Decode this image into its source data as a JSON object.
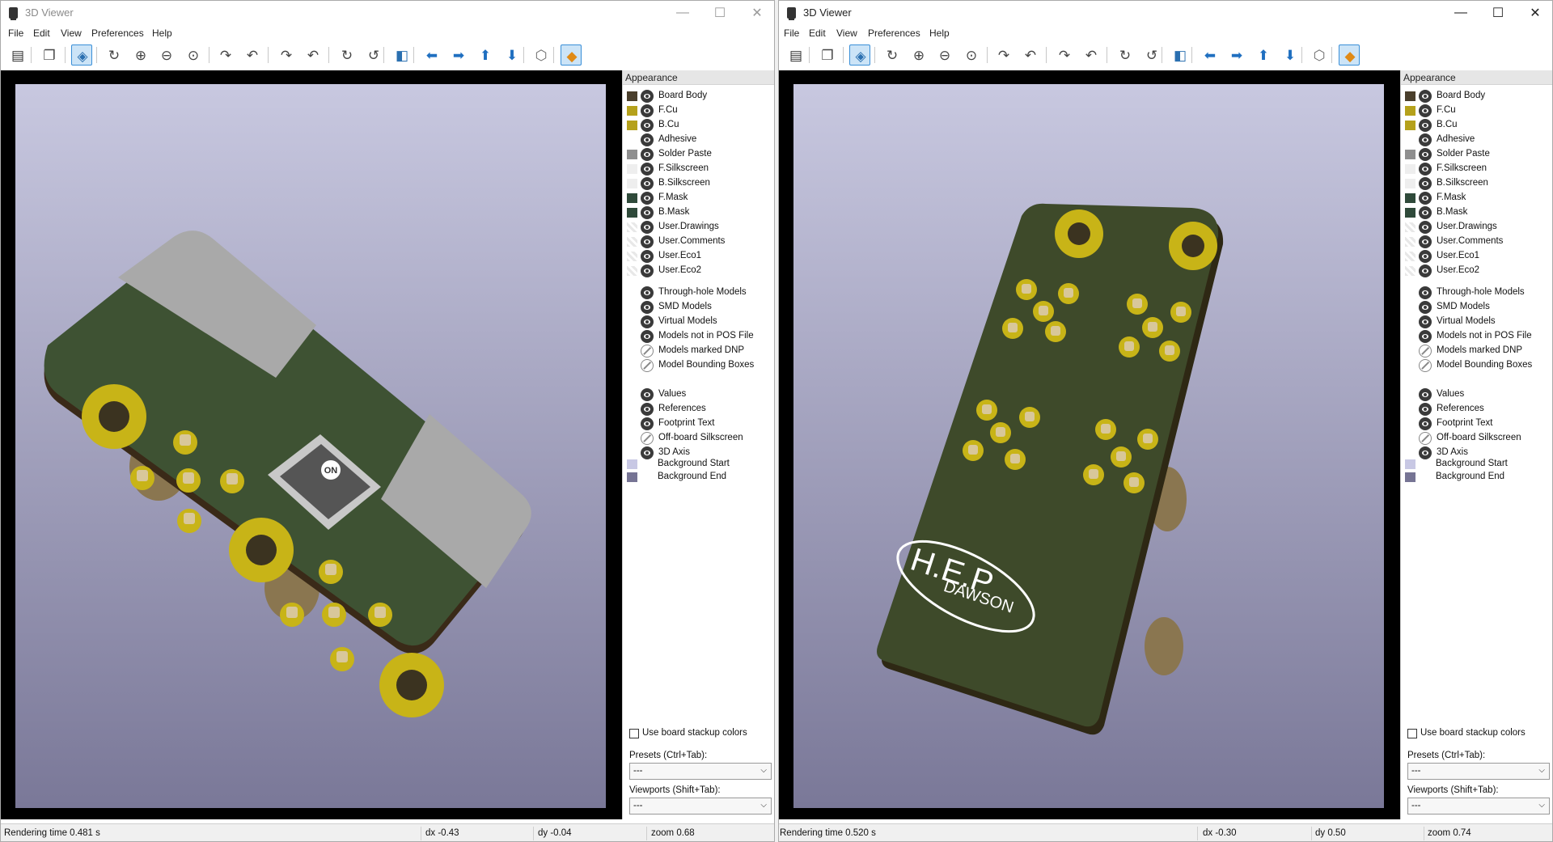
{
  "windows": [
    {
      "title": "3D Viewer",
      "active": false,
      "menu": [
        "File",
        "Edit",
        "View",
        "Preferences",
        "Help"
      ],
      "panel_title": "Appearance",
      "status": {
        "render": "Rendering time 0.481 s",
        "dx": "dx -0.43",
        "dy": "dy -0.04",
        "zoom": "zoom 0.68"
      }
    },
    {
      "title": "3D Viewer",
      "active": true,
      "menu": [
        "File",
        "Edit",
        "View",
        "Preferences",
        "Help"
      ],
      "panel_title": "Appearance",
      "status": {
        "render": "Rendering time 0.520 s",
        "dx": "dx -0.30",
        "dy": "dy 0.50",
        "zoom": "zoom 0.74"
      }
    }
  ],
  "layers": [
    {
      "label": "Board Body",
      "color": "#4a3f2c",
      "swatch": "solid",
      "visible": true
    },
    {
      "label": "F.Cu",
      "color": "#b5a11b",
      "swatch": "solid",
      "visible": true
    },
    {
      "label": "B.Cu",
      "color": "#b5a11b",
      "swatch": "solid",
      "visible": true
    },
    {
      "label": "Adhesive",
      "color": "#ffffff",
      "swatch": "none",
      "visible": true
    },
    {
      "label": "Solder Paste",
      "color": "#8f8f8f",
      "swatch": "solid",
      "visible": true
    },
    {
      "label": "F.Silkscreen",
      "color": "#eeeeee",
      "swatch": "solid",
      "visible": true
    },
    {
      "label": "B.Silkscreen",
      "color": "#eeeeee",
      "swatch": "solid",
      "visible": true
    },
    {
      "label": "F.Mask",
      "color": "#2f4a3a",
      "swatch": "solid",
      "visible": true
    },
    {
      "label": "B.Mask",
      "color": "#2f4a3a",
      "swatch": "solid",
      "visible": true
    },
    {
      "label": "User.Drawings",
      "color": "",
      "swatch": "checker",
      "visible": true
    },
    {
      "label": "User.Comments",
      "color": "",
      "swatch": "checker",
      "visible": true
    },
    {
      "label": "User.Eco1",
      "color": "",
      "swatch": "checker",
      "visible": true
    },
    {
      "label": "User.Eco2",
      "color": "",
      "swatch": "checker",
      "visible": true
    }
  ],
  "model_toggles": [
    {
      "label": "Through-hole Models",
      "visible": true
    },
    {
      "label": "SMD Models",
      "visible": true
    },
    {
      "label": "Virtual Models",
      "visible": true
    },
    {
      "label": "Models not in POS File",
      "visible": true
    },
    {
      "label": "Models marked DNP",
      "visible": false
    },
    {
      "label": "Model Bounding Boxes",
      "visible": false
    }
  ],
  "text_toggles": [
    {
      "label": "Values",
      "visible": true
    },
    {
      "label": "References",
      "visible": true
    },
    {
      "label": "Footprint Text",
      "visible": true
    },
    {
      "label": "Off-board Silkscreen",
      "visible": false
    }
  ],
  "axis_toggle": {
    "label": "3D Axis",
    "visible": true
  },
  "backgrounds": [
    {
      "label": "Background Start",
      "color": "#c8c8e4"
    },
    {
      "label": "Background End",
      "color": "#767494"
    }
  ],
  "stackup_checkbox": {
    "label": "Use board stackup colors",
    "checked": false
  },
  "presets": {
    "label": "Presets (Ctrl+Tab):",
    "value": "---"
  },
  "viewports": {
    "label": "Viewports (Shift+Tab):",
    "value": "---"
  },
  "pcb_silkscreen": {
    "logo_main": "H.E.P",
    "logo_sub": "DAWSON",
    "chip_mark": "ON"
  },
  "toolbar_icons": [
    {
      "name": "export-image-icon",
      "glyph": "▤",
      "color": "#333333",
      "on": false
    },
    {
      "name": "copy-clipboard-icon",
      "glyph": "❐",
      "color": "#444444",
      "on": false
    },
    {
      "name": "raytracing-icon",
      "glyph": "◈",
      "color": "#2a6fb0",
      "on": true
    },
    {
      "name": "reload-icon",
      "glyph": "↻",
      "color": "#444444",
      "on": false
    },
    {
      "name": "zoom-in-icon",
      "glyph": "⊕",
      "color": "#444444",
      "on": false
    },
    {
      "name": "zoom-out-icon",
      "glyph": "⊖",
      "color": "#444444",
      "on": false
    },
    {
      "name": "zoom-fit-icon",
      "glyph": "⊙",
      "color": "#444444",
      "on": false
    },
    {
      "name": "rotate-x-cw-icon",
      "glyph": "↷",
      "color": "#444444",
      "on": false
    },
    {
      "name": "rotate-x-ccw-icon",
      "glyph": "↶",
      "color": "#444444",
      "on": false
    },
    {
      "name": "rotate-y-cw-icon",
      "glyph": "↷",
      "color": "#444444",
      "on": false
    },
    {
      "name": "rotate-y-ccw-icon",
      "glyph": "↶",
      "color": "#444444",
      "on": false
    },
    {
      "name": "rotate-z-cw-icon",
      "glyph": "↻",
      "color": "#444444",
      "on": false
    },
    {
      "name": "rotate-z-ccw-icon",
      "glyph": "↺",
      "color": "#444444",
      "on": false
    },
    {
      "name": "flip-board-icon",
      "glyph": "◧",
      "color": "#2a6fb0",
      "on": false
    },
    {
      "name": "pan-left-icon",
      "glyph": "⬅",
      "color": "#1f6fc0",
      "on": false
    },
    {
      "name": "pan-right-icon",
      "glyph": "➡",
      "color": "#1f6fc0",
      "on": false
    },
    {
      "name": "pan-up-icon",
      "glyph": "⬆",
      "color": "#1f6fc0",
      "on": false
    },
    {
      "name": "pan-down-icon",
      "glyph": "⬇",
      "color": "#1f6fc0",
      "on": false
    },
    {
      "name": "ortho-view-icon",
      "glyph": "⬡",
      "color": "#666666",
      "on": false
    },
    {
      "name": "layers-manager-icon",
      "glyph": "◆",
      "color": "#e08a16",
      "on": true
    }
  ]
}
